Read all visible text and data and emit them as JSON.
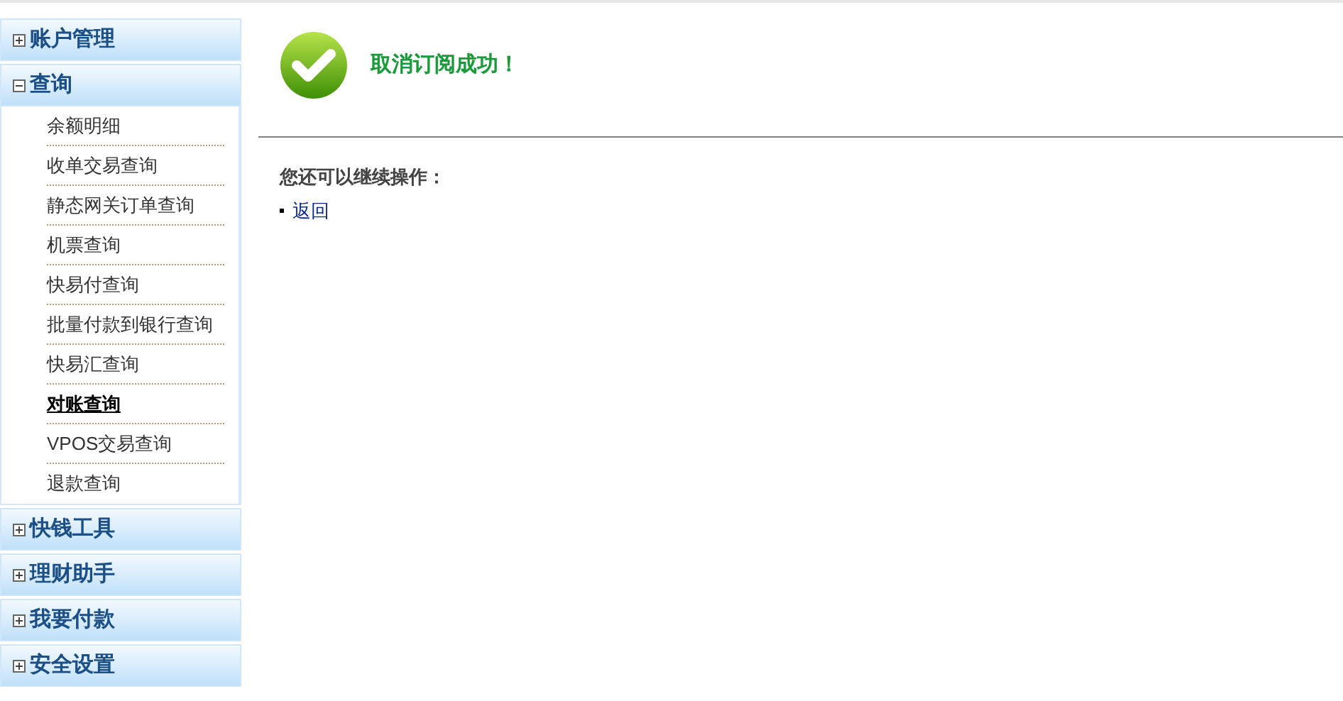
{
  "sidebar": {
    "sections": [
      {
        "title": "账户管理",
        "expanded": false
      },
      {
        "title": "查询",
        "expanded": true,
        "items": [
          {
            "label": "余额明细",
            "selected": false
          },
          {
            "label": "收单交易查询",
            "selected": false
          },
          {
            "label": "静态网关订单查询",
            "selected": false
          },
          {
            "label": "机票查询",
            "selected": false
          },
          {
            "label": "快易付查询",
            "selected": false
          },
          {
            "label": "批量付款到银行查询",
            "selected": false
          },
          {
            "label": "快易汇查询",
            "selected": false
          },
          {
            "label": "对账查询",
            "selected": true
          },
          {
            "label": "VPOS交易查询",
            "selected": false
          },
          {
            "label": "退款查询",
            "selected": false
          }
        ]
      },
      {
        "title": "快钱工具",
        "expanded": false
      },
      {
        "title": "理财助手",
        "expanded": false
      },
      {
        "title": "我要付款",
        "expanded": false
      },
      {
        "title": "安全设置",
        "expanded": false
      }
    ]
  },
  "message": {
    "title": "取消订阅成功！",
    "prompt": "您还可以继续操作：",
    "links": [
      "返回"
    ]
  }
}
